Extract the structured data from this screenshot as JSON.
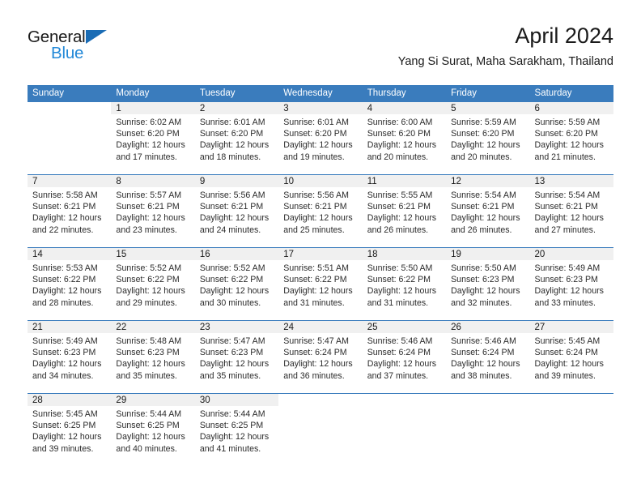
{
  "logo": {
    "word_one": "General",
    "word_two": "Blue",
    "triangle_color": "#1a6cb5",
    "blue_color": "#2389d8"
  },
  "header": {
    "title": "April 2024",
    "subtitle": "Yang Si Surat, Maha Sarakham, Thailand",
    "accent_color": "#3a7cbd",
    "daynum_band_color": "#f0f0f0"
  },
  "weekday_headers": [
    "Sunday",
    "Monday",
    "Tuesday",
    "Wednesday",
    "Thursday",
    "Friday",
    "Saturday"
  ],
  "weeks": [
    [
      {
        "day": "",
        "sunrise": "",
        "sunset": "",
        "daylight_1": "",
        "daylight_2": ""
      },
      {
        "day": "1",
        "sunrise": "Sunrise: 6:02 AM",
        "sunset": "Sunset: 6:20 PM",
        "daylight_1": "Daylight: 12 hours",
        "daylight_2": "and 17 minutes."
      },
      {
        "day": "2",
        "sunrise": "Sunrise: 6:01 AM",
        "sunset": "Sunset: 6:20 PM",
        "daylight_1": "Daylight: 12 hours",
        "daylight_2": "and 18 minutes."
      },
      {
        "day": "3",
        "sunrise": "Sunrise: 6:01 AM",
        "sunset": "Sunset: 6:20 PM",
        "daylight_1": "Daylight: 12 hours",
        "daylight_2": "and 19 minutes."
      },
      {
        "day": "4",
        "sunrise": "Sunrise: 6:00 AM",
        "sunset": "Sunset: 6:20 PM",
        "daylight_1": "Daylight: 12 hours",
        "daylight_2": "and 20 minutes."
      },
      {
        "day": "5",
        "sunrise": "Sunrise: 5:59 AM",
        "sunset": "Sunset: 6:20 PM",
        "daylight_1": "Daylight: 12 hours",
        "daylight_2": "and 20 minutes."
      },
      {
        "day": "6",
        "sunrise": "Sunrise: 5:59 AM",
        "sunset": "Sunset: 6:20 PM",
        "daylight_1": "Daylight: 12 hours",
        "daylight_2": "and 21 minutes."
      }
    ],
    [
      {
        "day": "7",
        "sunrise": "Sunrise: 5:58 AM",
        "sunset": "Sunset: 6:21 PM",
        "daylight_1": "Daylight: 12 hours",
        "daylight_2": "and 22 minutes."
      },
      {
        "day": "8",
        "sunrise": "Sunrise: 5:57 AM",
        "sunset": "Sunset: 6:21 PM",
        "daylight_1": "Daylight: 12 hours",
        "daylight_2": "and 23 minutes."
      },
      {
        "day": "9",
        "sunrise": "Sunrise: 5:56 AM",
        "sunset": "Sunset: 6:21 PM",
        "daylight_1": "Daylight: 12 hours",
        "daylight_2": "and 24 minutes."
      },
      {
        "day": "10",
        "sunrise": "Sunrise: 5:56 AM",
        "sunset": "Sunset: 6:21 PM",
        "daylight_1": "Daylight: 12 hours",
        "daylight_2": "and 25 minutes."
      },
      {
        "day": "11",
        "sunrise": "Sunrise: 5:55 AM",
        "sunset": "Sunset: 6:21 PM",
        "daylight_1": "Daylight: 12 hours",
        "daylight_2": "and 26 minutes."
      },
      {
        "day": "12",
        "sunrise": "Sunrise: 5:54 AM",
        "sunset": "Sunset: 6:21 PM",
        "daylight_1": "Daylight: 12 hours",
        "daylight_2": "and 26 minutes."
      },
      {
        "day": "13",
        "sunrise": "Sunrise: 5:54 AM",
        "sunset": "Sunset: 6:21 PM",
        "daylight_1": "Daylight: 12 hours",
        "daylight_2": "and 27 minutes."
      }
    ],
    [
      {
        "day": "14",
        "sunrise": "Sunrise: 5:53 AM",
        "sunset": "Sunset: 6:22 PM",
        "daylight_1": "Daylight: 12 hours",
        "daylight_2": "and 28 minutes."
      },
      {
        "day": "15",
        "sunrise": "Sunrise: 5:52 AM",
        "sunset": "Sunset: 6:22 PM",
        "daylight_1": "Daylight: 12 hours",
        "daylight_2": "and 29 minutes."
      },
      {
        "day": "16",
        "sunrise": "Sunrise: 5:52 AM",
        "sunset": "Sunset: 6:22 PM",
        "daylight_1": "Daylight: 12 hours",
        "daylight_2": "and 30 minutes."
      },
      {
        "day": "17",
        "sunrise": "Sunrise: 5:51 AM",
        "sunset": "Sunset: 6:22 PM",
        "daylight_1": "Daylight: 12 hours",
        "daylight_2": "and 31 minutes."
      },
      {
        "day": "18",
        "sunrise": "Sunrise: 5:50 AM",
        "sunset": "Sunset: 6:22 PM",
        "daylight_1": "Daylight: 12 hours",
        "daylight_2": "and 31 minutes."
      },
      {
        "day": "19",
        "sunrise": "Sunrise: 5:50 AM",
        "sunset": "Sunset: 6:23 PM",
        "daylight_1": "Daylight: 12 hours",
        "daylight_2": "and 32 minutes."
      },
      {
        "day": "20",
        "sunrise": "Sunrise: 5:49 AM",
        "sunset": "Sunset: 6:23 PM",
        "daylight_1": "Daylight: 12 hours",
        "daylight_2": "and 33 minutes."
      }
    ],
    [
      {
        "day": "21",
        "sunrise": "Sunrise: 5:49 AM",
        "sunset": "Sunset: 6:23 PM",
        "daylight_1": "Daylight: 12 hours",
        "daylight_2": "and 34 minutes."
      },
      {
        "day": "22",
        "sunrise": "Sunrise: 5:48 AM",
        "sunset": "Sunset: 6:23 PM",
        "daylight_1": "Daylight: 12 hours",
        "daylight_2": "and 35 minutes."
      },
      {
        "day": "23",
        "sunrise": "Sunrise: 5:47 AM",
        "sunset": "Sunset: 6:23 PM",
        "daylight_1": "Daylight: 12 hours",
        "daylight_2": "and 35 minutes."
      },
      {
        "day": "24",
        "sunrise": "Sunrise: 5:47 AM",
        "sunset": "Sunset: 6:24 PM",
        "daylight_1": "Daylight: 12 hours",
        "daylight_2": "and 36 minutes."
      },
      {
        "day": "25",
        "sunrise": "Sunrise: 5:46 AM",
        "sunset": "Sunset: 6:24 PM",
        "daylight_1": "Daylight: 12 hours",
        "daylight_2": "and 37 minutes."
      },
      {
        "day": "26",
        "sunrise": "Sunrise: 5:46 AM",
        "sunset": "Sunset: 6:24 PM",
        "daylight_1": "Daylight: 12 hours",
        "daylight_2": "and 38 minutes."
      },
      {
        "day": "27",
        "sunrise": "Sunrise: 5:45 AM",
        "sunset": "Sunset: 6:24 PM",
        "daylight_1": "Daylight: 12 hours",
        "daylight_2": "and 39 minutes."
      }
    ],
    [
      {
        "day": "28",
        "sunrise": "Sunrise: 5:45 AM",
        "sunset": "Sunset: 6:25 PM",
        "daylight_1": "Daylight: 12 hours",
        "daylight_2": "and 39 minutes."
      },
      {
        "day": "29",
        "sunrise": "Sunrise: 5:44 AM",
        "sunset": "Sunset: 6:25 PM",
        "daylight_1": "Daylight: 12 hours",
        "daylight_2": "and 40 minutes."
      },
      {
        "day": "30",
        "sunrise": "Sunrise: 5:44 AM",
        "sunset": "Sunset: 6:25 PM",
        "daylight_1": "Daylight: 12 hours",
        "daylight_2": "and 41 minutes."
      },
      {
        "day": "",
        "sunrise": "",
        "sunset": "",
        "daylight_1": "",
        "daylight_2": ""
      },
      {
        "day": "",
        "sunrise": "",
        "sunset": "",
        "daylight_1": "",
        "daylight_2": ""
      },
      {
        "day": "",
        "sunrise": "",
        "sunset": "",
        "daylight_1": "",
        "daylight_2": ""
      },
      {
        "day": "",
        "sunrise": "",
        "sunset": "",
        "daylight_1": "",
        "daylight_2": ""
      }
    ]
  ]
}
